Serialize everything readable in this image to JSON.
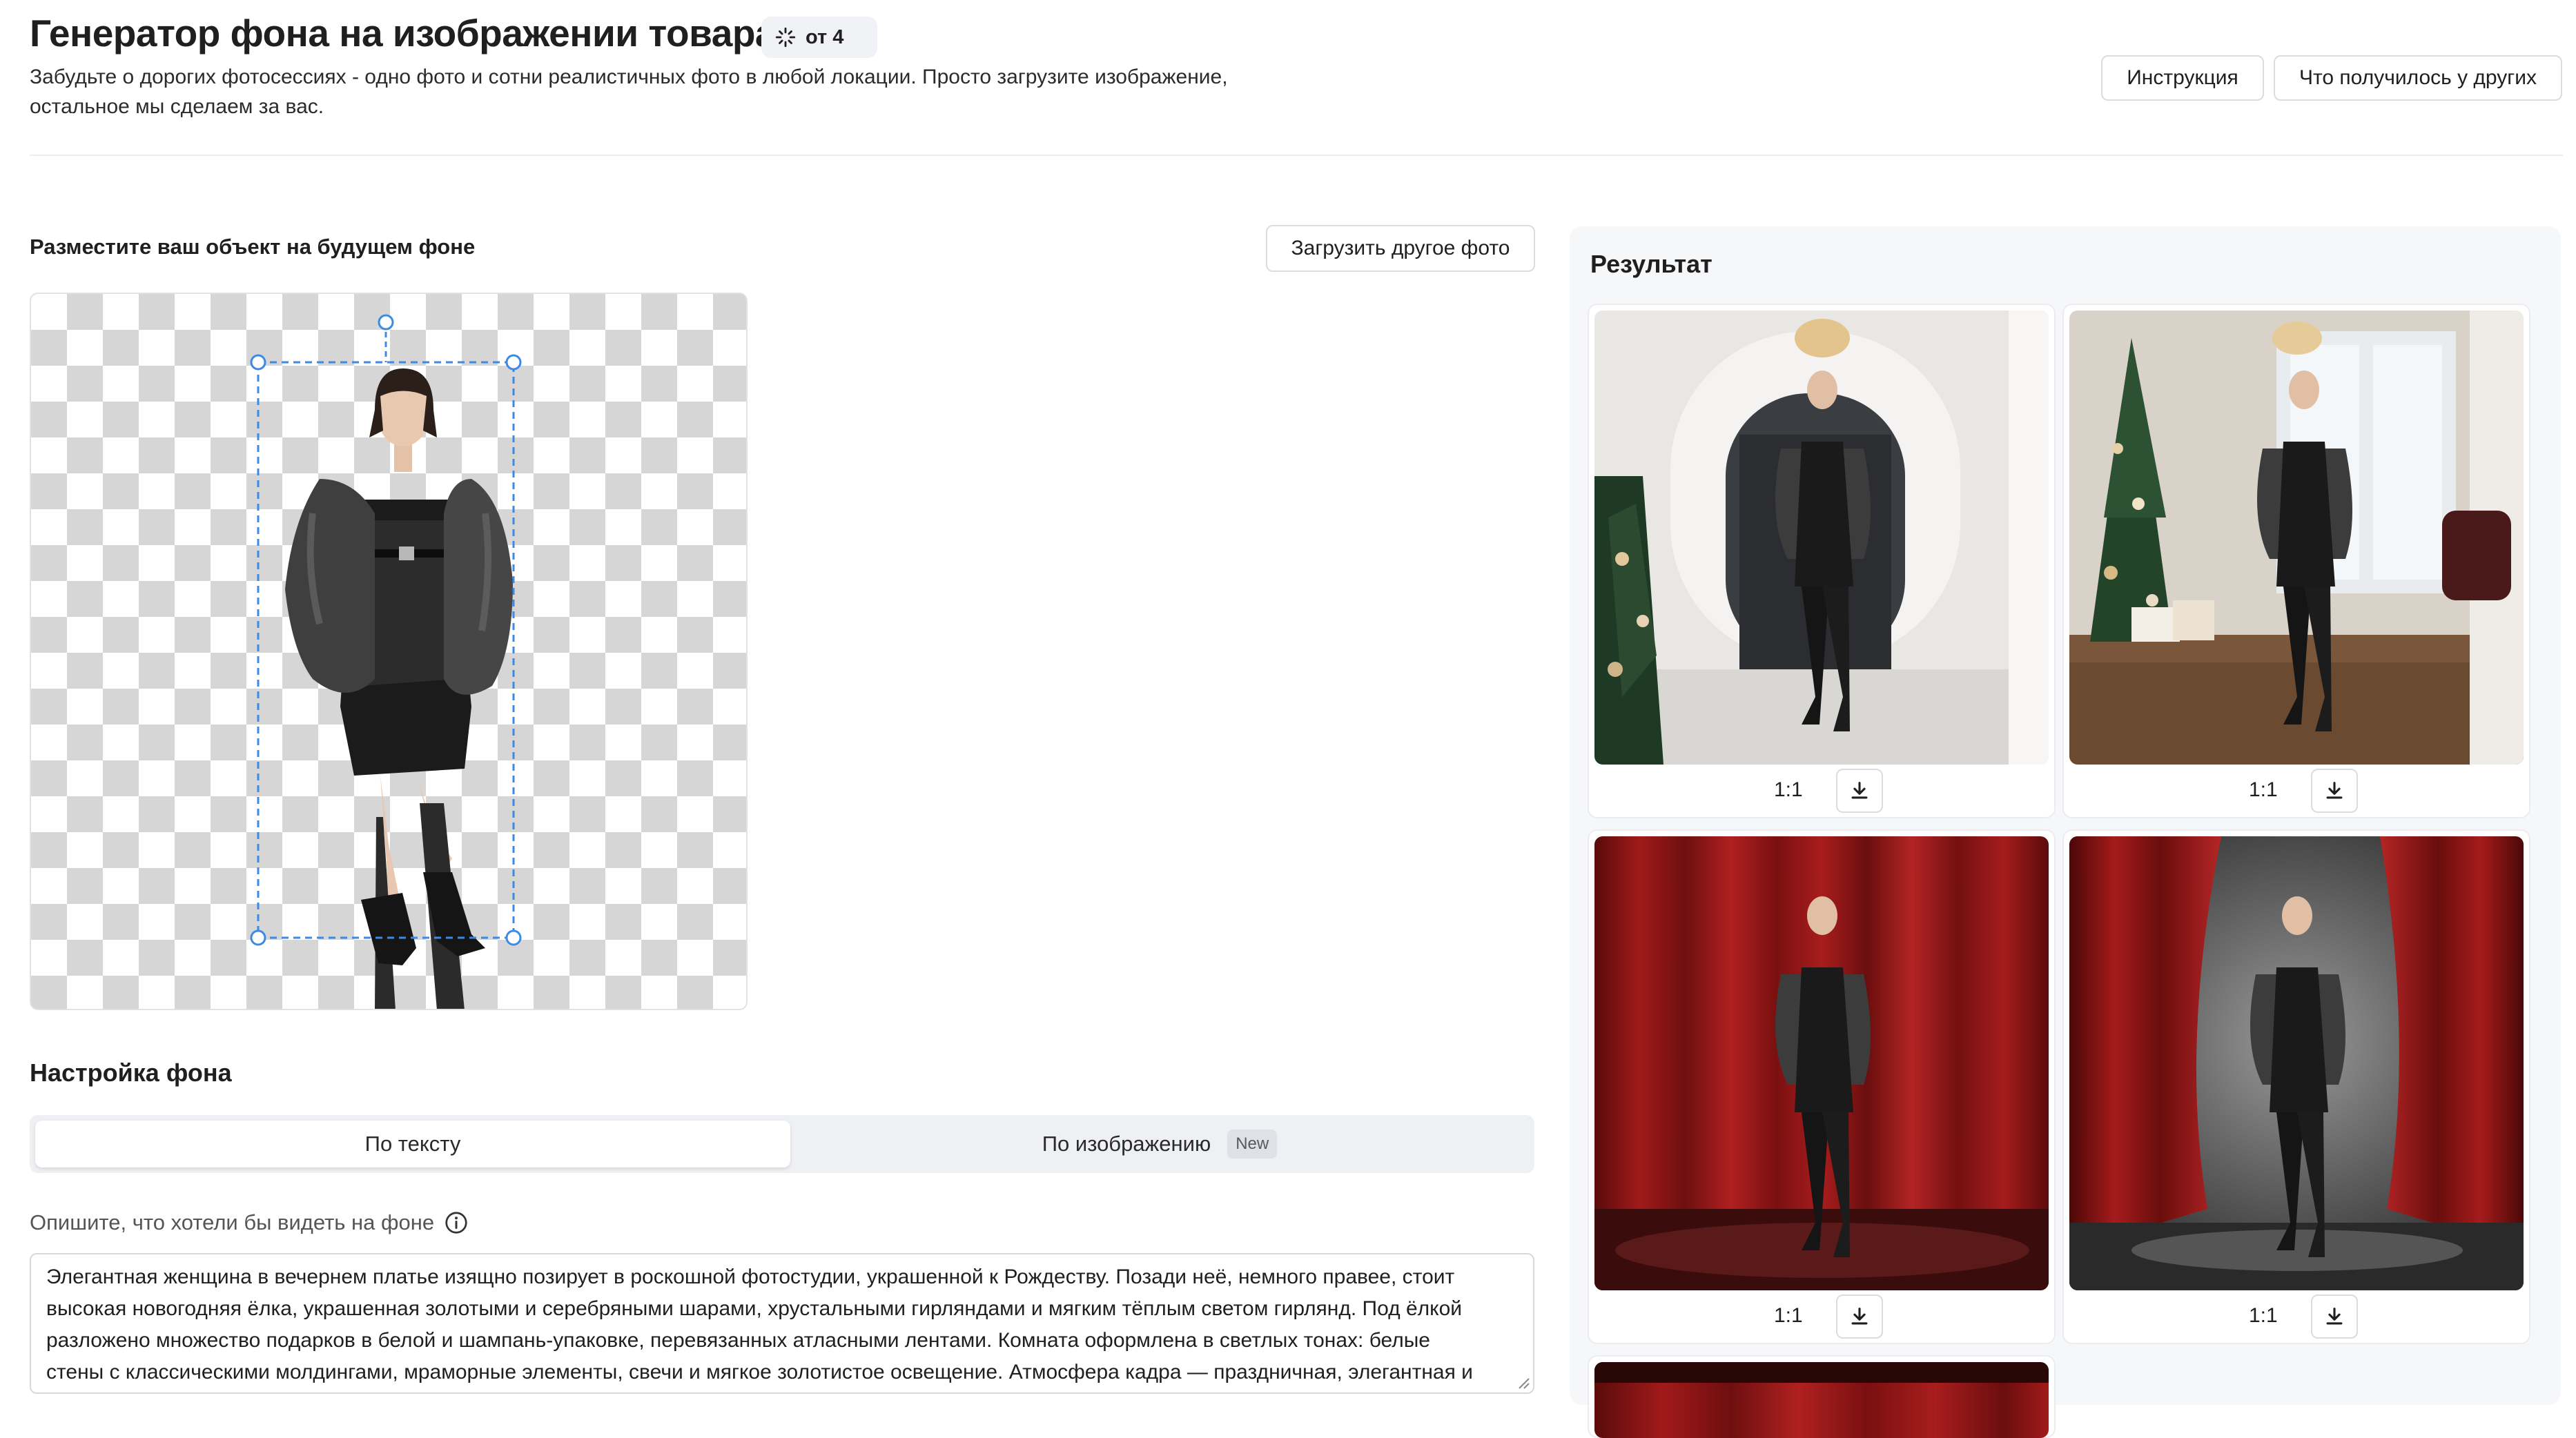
{
  "header": {
    "title": "Генератор фона на изображении товара",
    "badge_label": "от 4",
    "subtitle_line1": "Забудьте о дорогих фотосессиях - одно фото и сотни реалистичных фото в любой локации. Просто загрузите изображение,",
    "subtitle_line2": "остальное мы сделаем за вас.",
    "instruction_button": "Инструкция",
    "others_button": "Что получилось у других"
  },
  "editor": {
    "place_label": "Разместите ваш объект на будущем фоне",
    "upload_button": "Загрузить другое фото"
  },
  "background_settings": {
    "heading": "Настройка фона",
    "tabs": [
      {
        "label": "По тексту",
        "active": true
      },
      {
        "label": "По изображению",
        "badge": "New",
        "active": false
      }
    ],
    "prompt_label": "Опишите, что хотели бы видеть на фоне",
    "prompt_lines": [
      "Элегантная женщина в вечернем платье изящно позирует в роскошной фотостудии, украшенной к Рождеству. Позади неё, немного правее, стоит",
      "высокая новогодняя ёлка, украшенная золотыми и серебряными шарами, хрустальными гирляндами и мягким тёплым светом гирлянд. Под ёлкой",
      "разложено множество подарков в белой и шампань-упаковке, перевязанных атласными лентами. Комната оформлена в светлых тонах: белые",
      "стены с классическими молдингами, мраморные элементы, свечи и мягкое золотистое освещение. Атмосфера кадра — праздничная, элегантная и"
    ]
  },
  "result": {
    "heading": "Результат",
    "cards": [
      {
        "ratio": "1:1",
        "scene": "white-hall-christmas"
      },
      {
        "ratio": "1:1",
        "scene": "christmas-tree-window"
      },
      {
        "ratio": "1:1",
        "scene": "red-curtain"
      },
      {
        "ratio": "1:1",
        "scene": "red-curtain-grey-backdrop"
      }
    ]
  },
  "colors": {
    "accent_blue": "#3b8ae6",
    "curtain_red": "#8e1414",
    "checker_grey": "#d6d6d6"
  }
}
